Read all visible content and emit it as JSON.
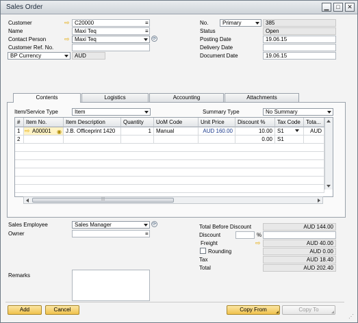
{
  "window": {
    "title": "Sales Order"
  },
  "header": {
    "customer_label": "Customer",
    "customer_value": "C20000",
    "name_label": "Name",
    "name_value": "Maxi Teq",
    "contact_label": "Contact Person",
    "contact_value": "Maxi Teq",
    "ref_label": "Customer Ref. No.",
    "ref_value": "",
    "currency_label": "BP Currency",
    "currency_value": "AUD",
    "no_label": "No.",
    "no_series": "Primary",
    "no_value": "385",
    "status_label": "Status",
    "status_value": "Open",
    "posting_label": "Posting Date",
    "posting_value": "19.06.15",
    "delivery_label": "Delivery Date",
    "delivery_value": "",
    "document_label": "Document Date",
    "document_value": "19.06.15"
  },
  "tabs": [
    "Contents",
    "Logistics",
    "Accounting",
    "Attachments"
  ],
  "contents": {
    "type_label": "Item/Service Type",
    "type_value": "Item",
    "summary_label": "Summary Type",
    "summary_value": "No Summary",
    "columns": [
      "#",
      "Item No.",
      "Item Description",
      "Quantity",
      "UoM Code",
      "Unit Price",
      "Discount %",
      "Tax Code",
      "Tota..."
    ],
    "rows": [
      {
        "num": "1",
        "item": "A00001",
        "desc": "J.B. Officeprint 1420",
        "qty": "1",
        "uom": "Manual",
        "price": "AUD 160.00",
        "disc": "10.00",
        "tax": "S1",
        "total": "AUD"
      },
      {
        "num": "2",
        "item": "",
        "desc": "",
        "qty": "",
        "uom": "",
        "price": "",
        "disc": "0.00",
        "tax": "S1",
        "total": ""
      }
    ]
  },
  "footer": {
    "employee_label": "Sales Employee",
    "employee_value": "Sales Manager",
    "owner_label": "Owner",
    "owner_value": "",
    "remarks_label": "Remarks",
    "tbd_label": "Total Before Discount",
    "tbd_value": "AUD 144.00",
    "discount_label": "Discount",
    "discount_pct": "",
    "pct_sign": "%",
    "discount_value": "",
    "freight_label": "Freight",
    "freight_value": "AUD 40.00",
    "rounding_label": "Rounding",
    "rounding_value": "AUD 0.00",
    "tax_label": "Tax",
    "tax_value": "AUD 18.40",
    "total_label": "Total",
    "total_value": "AUD 202.40"
  },
  "buttons": {
    "add": "Add",
    "cancel": "Cancel",
    "copy_from": "Copy From",
    "copy_to": "Copy To"
  },
  "colors": {
    "accent": "#f0c14c",
    "link_arrow": "#e4a800"
  }
}
